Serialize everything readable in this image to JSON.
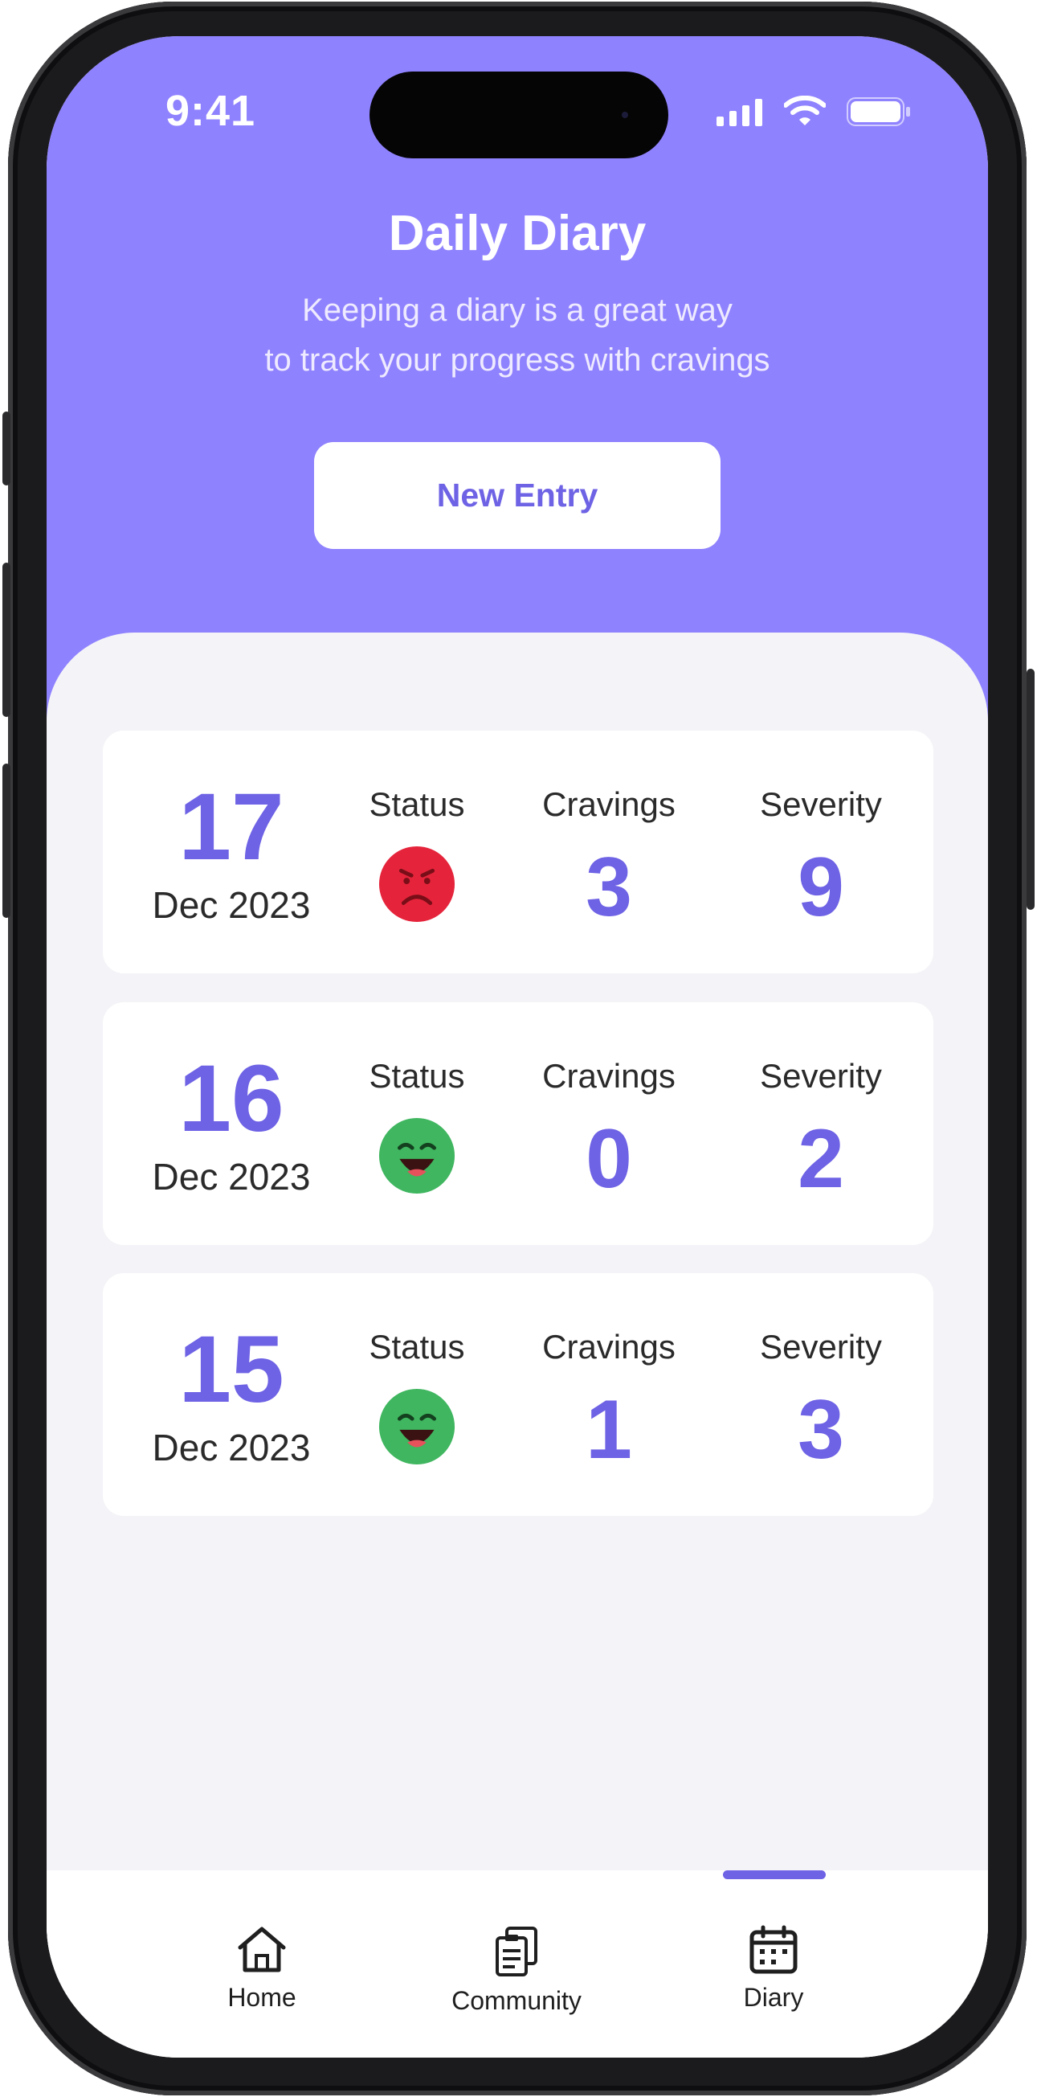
{
  "status_bar": {
    "time": "9:41"
  },
  "header": {
    "title": "Daily Diary",
    "subtitle_line1": "Keeping a diary is a great way",
    "subtitle_line2": "to track your progress with cravings",
    "new_entry_label": "New Entry"
  },
  "entries": [
    {
      "day": "17",
      "month_year": "Dec 2023",
      "status_label": "Status",
      "status": "sad-face-icon",
      "cravings_label": "Cravings",
      "cravings": "3",
      "severity_label": "Severity",
      "severity": "9"
    },
    {
      "day": "16",
      "month_year": "Dec 2023",
      "status_label": "Status",
      "status": "happy-face-icon",
      "cravings_label": "Cravings",
      "cravings": "0",
      "severity_label": "Severity",
      "severity": "2"
    },
    {
      "day": "15",
      "month_year": "Dec 2023",
      "status_label": "Status",
      "status": "happy-face-icon",
      "cravings_label": "Cravings",
      "cravings": "1",
      "severity_label": "Severity",
      "severity": "3"
    }
  ],
  "tab_bar": {
    "items": [
      {
        "label": "Home",
        "icon": "home-icon"
      },
      {
        "label": "Community",
        "icon": "clipboard-icon"
      },
      {
        "label": "Diary",
        "icon": "calendar-icon"
      }
    ],
    "active": "Diary"
  },
  "colors": {
    "header": "#8f82fe",
    "accent": "#6e62e5",
    "background": "#f4f4f8",
    "sad": "#e5243b",
    "happy": "#3fb65f"
  }
}
